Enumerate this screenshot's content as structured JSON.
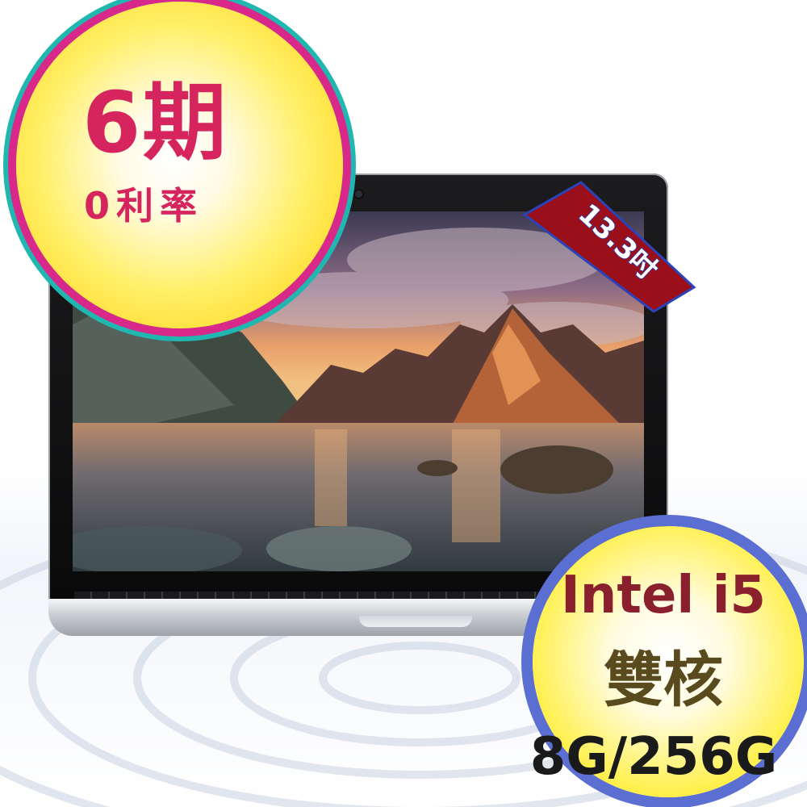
{
  "promo": {
    "main_text": "6期",
    "sub_text": "0利率",
    "colors": {
      "text": "#d6245e",
      "ring_outer": "#20b7b1",
      "ring_inner": "#d8288a",
      "fill": "#fff06a"
    }
  },
  "size_tag": {
    "text": "13.3吋",
    "colors": {
      "ribbon": "#9a0f1a",
      "text": "#ffffff",
      "outline": "#2a43b8"
    }
  },
  "specs": {
    "cpu": "Intel i5",
    "cores": "雙核",
    "memory_storage": "8G/256G",
    "colors": {
      "ring": "#5b6fd3",
      "cpu_text": "#8a1f2e",
      "cores_text": "#5a4b1e",
      "memory_text": "#1a1a1a",
      "fill": "#fff04d"
    }
  },
  "product": {
    "image": "laptop-with-mountain-lake-wallpaper",
    "icons": [
      "camera-icon"
    ]
  }
}
